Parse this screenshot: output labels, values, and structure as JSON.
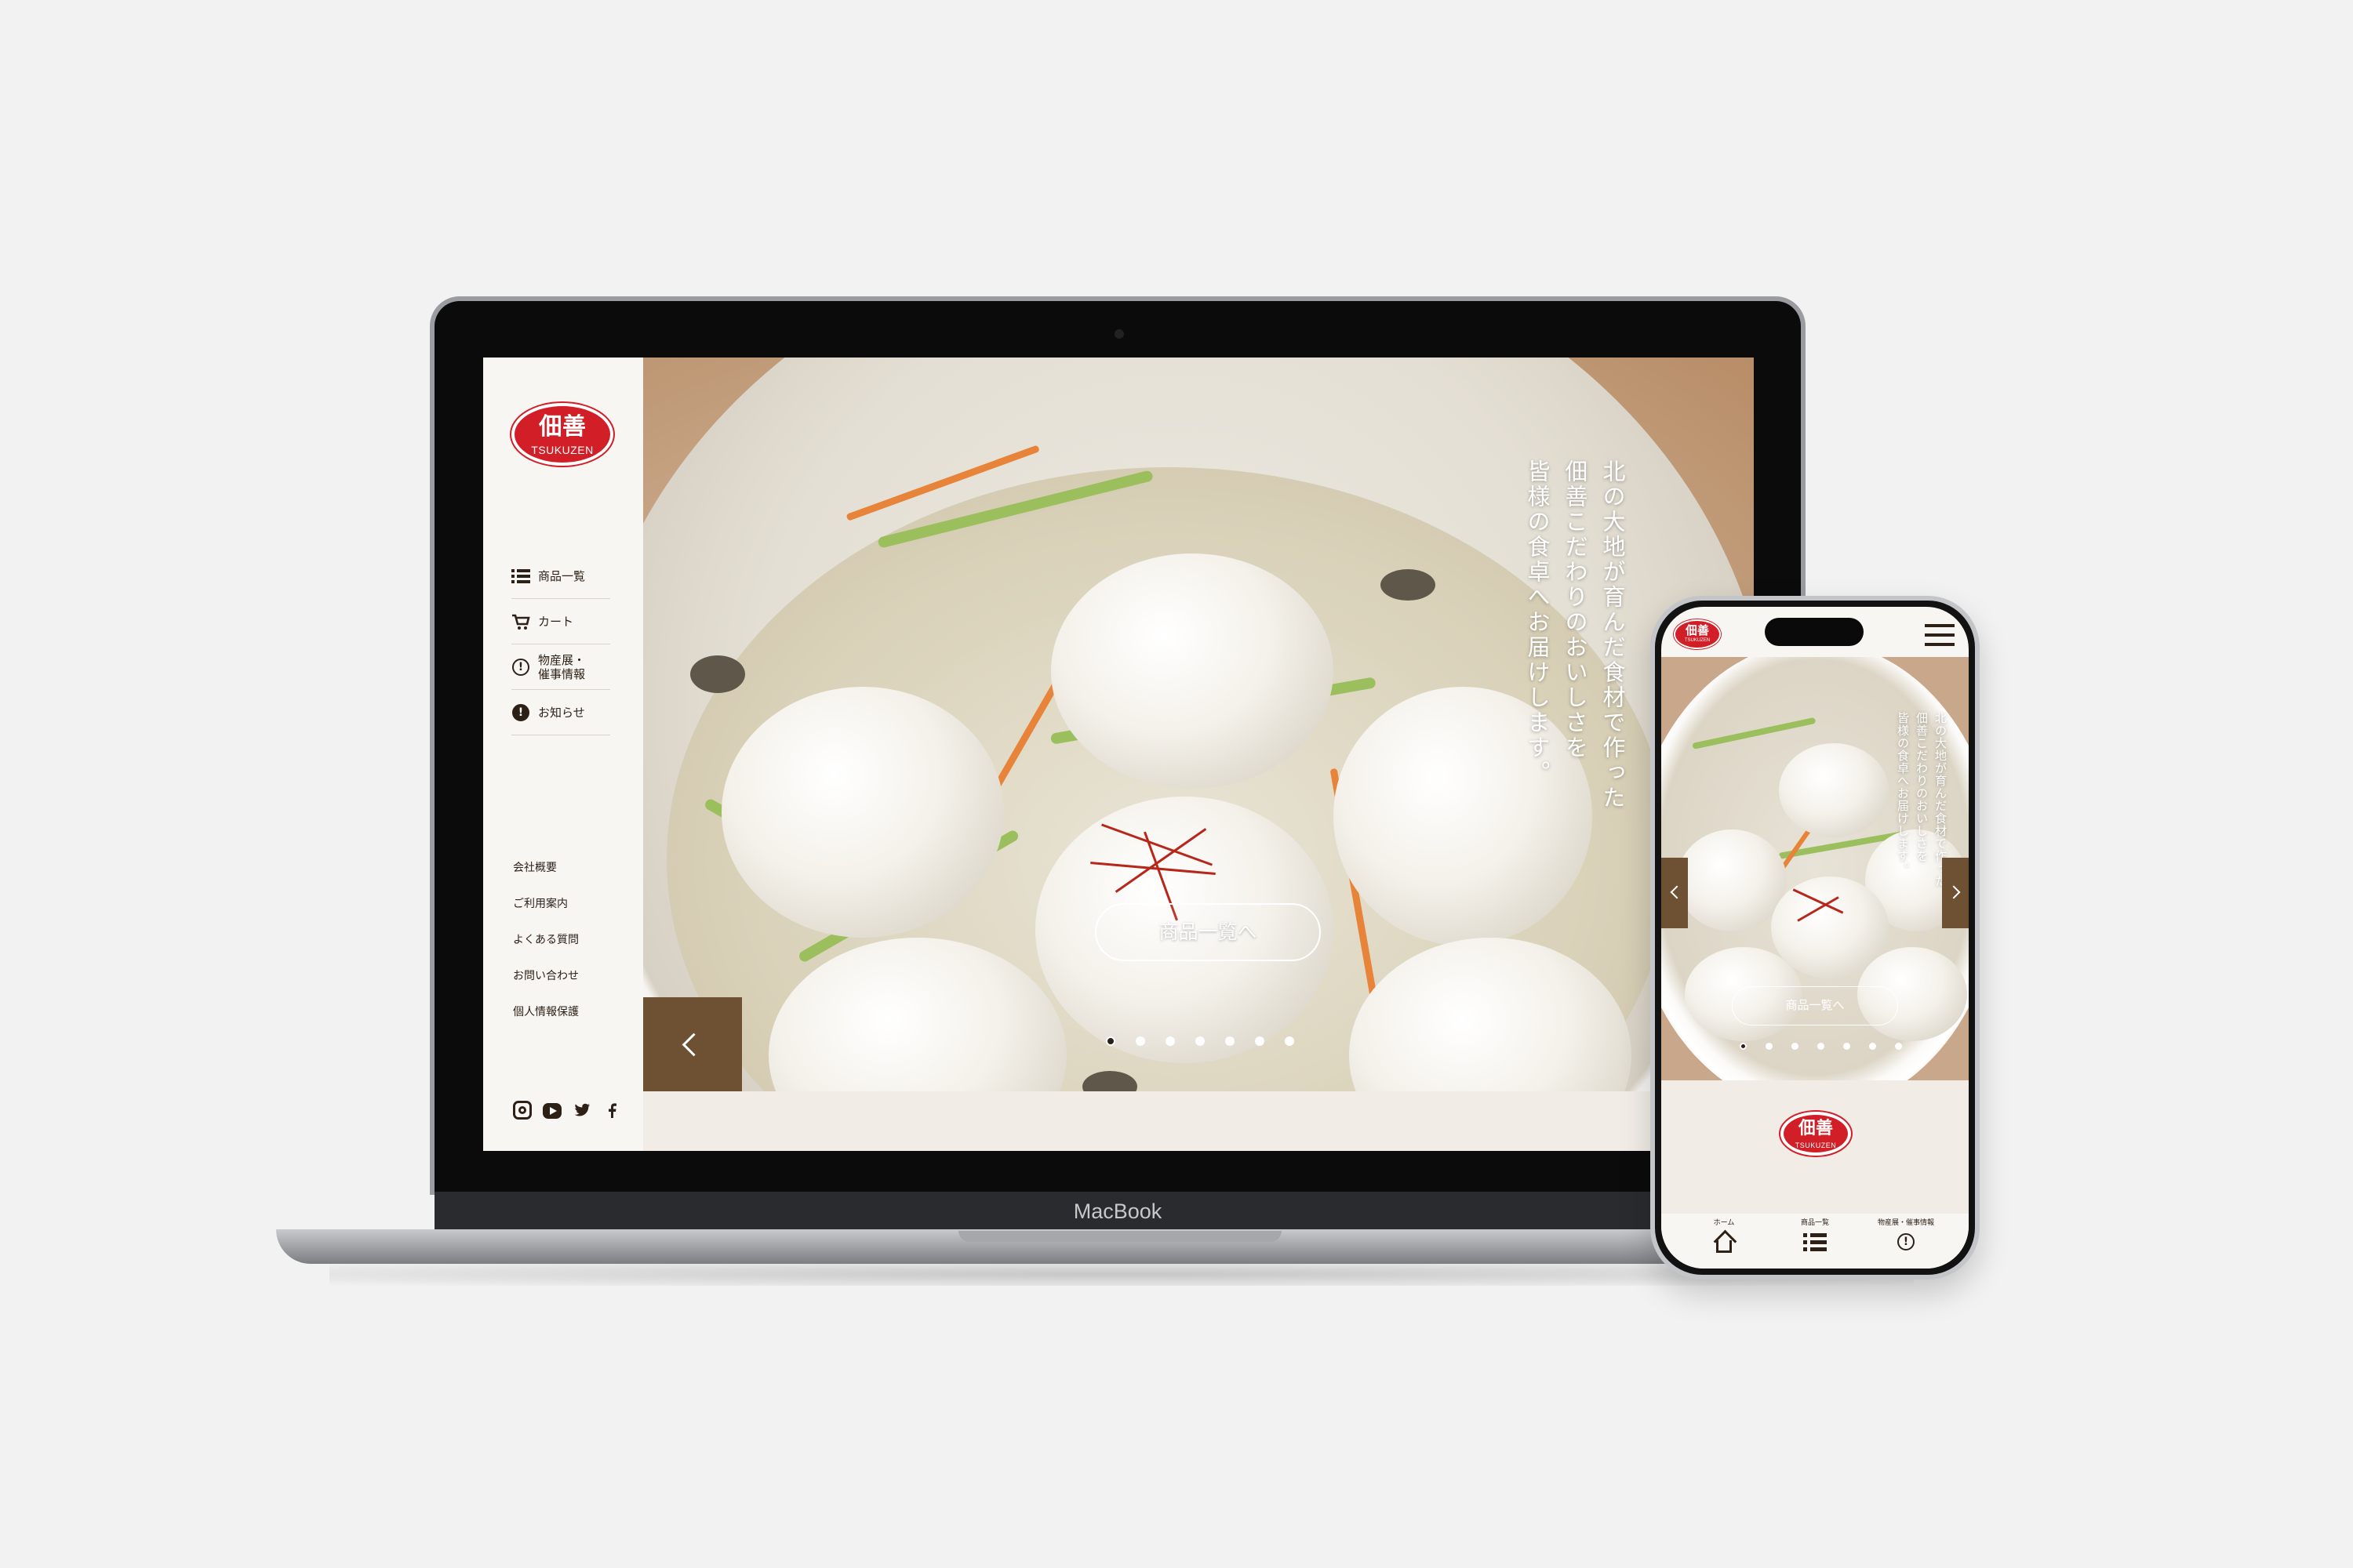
{
  "laptop": {
    "brand": "MacBook"
  },
  "site": {
    "logo_kanji": "佃善",
    "logo_latin": "TSUKUZEN",
    "nav": [
      {
        "label": "商品一覧",
        "icon": "list-icon"
      },
      {
        "label": "カート",
        "icon": "cart-icon"
      },
      {
        "label": "物産展・\n催事情報",
        "icon": "info-circle-icon"
      },
      {
        "label": "お知らせ",
        "icon": "alert-circle-icon"
      }
    ],
    "sub_links": [
      "会社概要",
      "ご利用案内",
      "よくある質問",
      "お問い合わせ",
      "個人情報保護"
    ],
    "social": [
      "instagram-icon",
      "youtube-icon",
      "twitter-icon",
      "facebook-icon"
    ],
    "hero": {
      "copy_lines": [
        "北の大地が育んだ食材で作った",
        "佃善こだわりのおいしさを",
        "皆様の食卓へお届けします。"
      ],
      "cta_label": "商品一覧へ",
      "slides_total": 7,
      "active_slide": 1
    },
    "colors": {
      "brand_red": "#d21f27",
      "dark_brown": "#2d2016",
      "accent_brown": "#6d5132",
      "background": "#f8f6f2"
    }
  },
  "mobile": {
    "tabbar": [
      {
        "label": "ホーム",
        "icon": "home-icon"
      },
      {
        "label": "商品一覧",
        "icon": "list-icon"
      },
      {
        "label": "物産展・催事情報",
        "icon": "info-circle-icon"
      }
    ]
  }
}
